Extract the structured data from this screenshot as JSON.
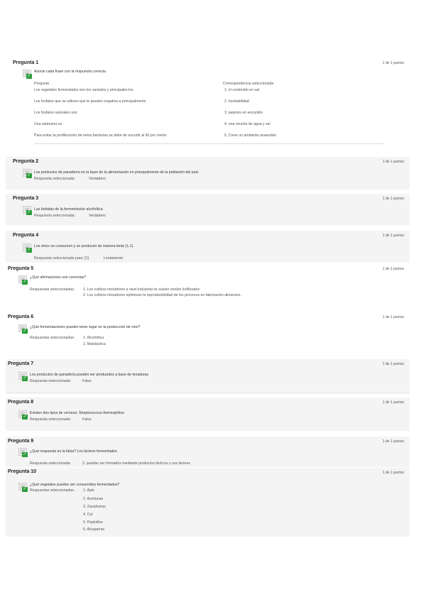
{
  "questions": [
    {
      "title": "Pregunta 1",
      "score": "1 de 1 puntos",
      "prompt": "Asocie cada frase con la respuesta correcta",
      "col_question": "Pregunta",
      "col_answer": "Correspondencia seleccionada",
      "rows": [
        {
          "q": "Los vegetales fermentados son los variados y principales los",
          "a": "1. el contenido en sal"
        },
        {
          "q": "Los fosfatos que se utilizan que le pueden negativa a principalmente",
          "a": "2. inestabilidad"
        },
        {
          "q": "Los fosfatos naturales son",
          "a": "3. pepinos en encurtido"
        },
        {
          "q": "Una salmuera es",
          "a": "4. una mezcla de agua y sal"
        },
        {
          "q": "Para evitar la proliferación de estos bacterias se debe de encurtir al 60 por ciento",
          "a": "5. Crear un ambiente anaerobio"
        }
      ]
    },
    {
      "title": "Pregunta 2",
      "score": "1 de 1 puntos",
      "prompt": "Los productos de panadería en la base de la alimentación en principalmente de la población del país",
      "answer_label": "Respuesta seleccionada:",
      "answer": "Verdadero"
    },
    {
      "title": "Pregunta 3",
      "score": "1 de 1 puntos",
      "prompt": "Las bebidas de la fermentación alcohólica",
      "answer_label": "Respuesta seleccionada:",
      "answer": "Verdadero"
    },
    {
      "title": "Pregunta 4",
      "score": "1 de 1 puntos",
      "prompt": "Los vinos se consumen y se producen de manera lenta (1.1).",
      "answer_label": "Respuesta seleccionada para: [1]",
      "answer": "Lentamente"
    },
    {
      "title": "Pregunta 5",
      "score": "1 de 1 puntos",
      "prompt": "¿Qué afirmaciones son correctas?",
      "answer_label": "Respuestas seleccionadas:",
      "answers": [
        "1. Los cultivos iniciadores a nivel industrial se suelen vender liofilizados",
        "2. Los cultivos iniciadores optimizan la reproducibilidad de los procesos en fabricación alimentos."
      ]
    },
    {
      "title": "Pregunta 6",
      "score": "1 de 1 puntos",
      "prompt": "¿Qué fermentaciones pueden tener lugar en la producción de vino?",
      "answer_label": "Respuestas seleccionadas:",
      "answers": [
        "1. Alcohólica",
        "2. Maloláctica"
      ]
    },
    {
      "title": "Pregunta 7",
      "score": "1 de 1 puntos",
      "prompt": "Los productos de panadería pueden ser producidos a base de levaduras",
      "answer_label": "Respuesta seleccionada:",
      "answer": "Falso"
    },
    {
      "title": "Pregunta 8",
      "score": "1 de 1 puntos",
      "prompt": "Existen dos tipos de cerveza: Streptococcus thermophilus",
      "answer_label": "Respuesta seleccionada:",
      "answer": "Falso"
    },
    {
      "title": "Pregunta 9",
      "score": "1 de 1 puntos",
      "prompt": "¿Qué respuesta es la falsa? Los lácteos fermentados",
      "answer_label": "Respuesta seleccionada:",
      "answer": "2. puedan ser formados mediante productos lácticos y sus lácteos"
    },
    {
      "title": "Pregunta 10",
      "score": "1 de 1 puntos",
      "prompt": "¿Qué vegetales pueden ser consumidos fermentados?",
      "answer_label": "Respuestas seleccionadas:",
      "answers": [
        "1. Apio",
        "2. Aceitunas",
        "3. Zanahorias",
        "4. Col",
        "5. Pepinillos",
        "6. Alcaparras"
      ]
    }
  ]
}
